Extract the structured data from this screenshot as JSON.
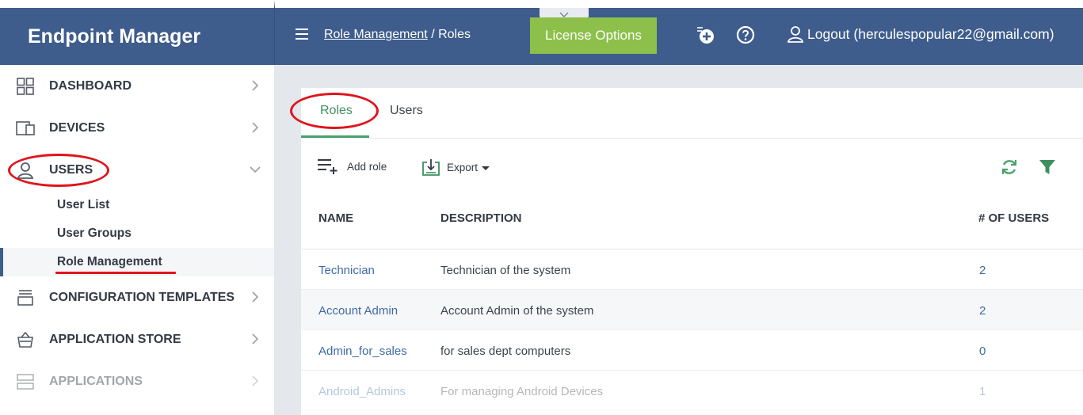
{
  "app": {
    "brand": "Endpoint Manager"
  },
  "sidebar": {
    "items": [
      {
        "label": "DASHBOARD",
        "icon": "dashboard-grid-icon"
      },
      {
        "label": "DEVICES",
        "icon": "devices-icon"
      },
      {
        "label": "USERS",
        "icon": "user-icon",
        "expanded": true
      },
      {
        "label": "CONFIGURATION TEMPLATES",
        "icon": "template-stack-icon"
      },
      {
        "label": "APPLICATION STORE",
        "icon": "store-basket-icon"
      },
      {
        "label": "APPLICATIONS",
        "icon": "applications-icon"
      }
    ],
    "users_sub": [
      {
        "label": "User List"
      },
      {
        "label": "User Groups"
      },
      {
        "label": "Role Management",
        "active": true
      }
    ]
  },
  "topbar": {
    "breadcrumb_link": "Role Management",
    "breadcrumb_sep": " / ",
    "breadcrumb_current": "Roles",
    "license_button": "License Options",
    "logout": "Logout (herculespopular22@gmail.com)"
  },
  "tabs": [
    {
      "label": "Roles",
      "active": true
    },
    {
      "label": "Users",
      "active": false
    }
  ],
  "toolbar": {
    "add_role": "Add role",
    "export": "Export"
  },
  "table": {
    "columns": [
      "NAME",
      "DESCRIPTION",
      "# OF USERS"
    ],
    "rows": [
      {
        "name": "Technician",
        "description": "Technician of the system",
        "users": "2"
      },
      {
        "name": "Account Admin",
        "description": "Account Admin of the system",
        "users": "2"
      },
      {
        "name": "Admin_for_sales",
        "description": "for sales dept computers",
        "users": "0"
      },
      {
        "name": "Android_Admins",
        "description": "For managing Android Devices",
        "users": "1"
      }
    ]
  },
  "colors": {
    "header_blue": "#3e5c8c",
    "license_green": "#8dc04b",
    "tab_active_green": "#3e8e5f",
    "link_blue": "#3f69a8",
    "highlight_red": "#e0141c"
  }
}
